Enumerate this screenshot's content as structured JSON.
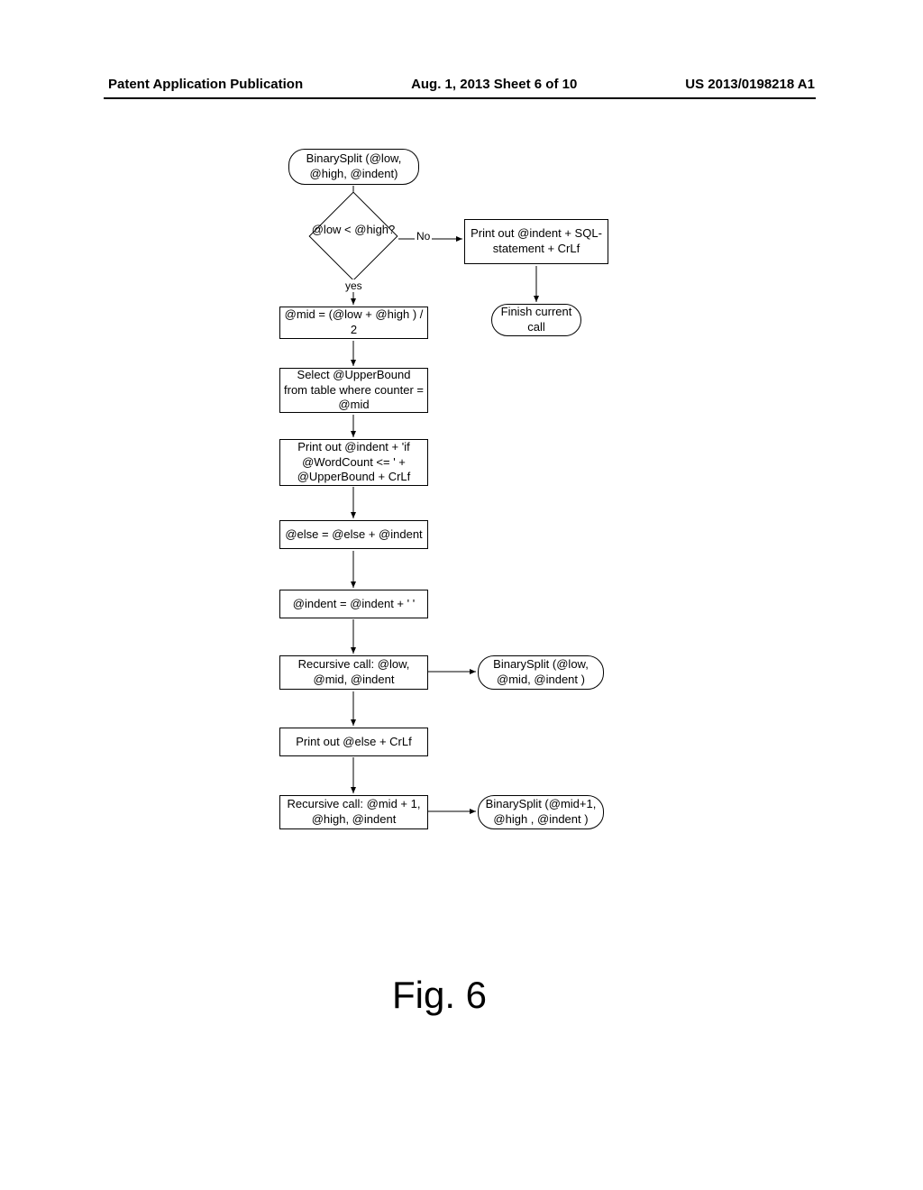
{
  "header": {
    "left": "Patent Application Publication",
    "center": "Aug. 1, 2013   Sheet 6 of 10",
    "right": "US 2013/0198218 A1"
  },
  "diagram": {
    "start": "BinarySplit (@low, @high, @indent)",
    "decision": "@low < @high?",
    "no_label": "No",
    "yes_label": "yes",
    "print_sql": "Print out @indent + SQL-statement + CrLf",
    "finish": "Finish current call",
    "mid_calc": "@mid = (@low + @high ) / 2",
    "select_upper": "Select @UpperBound from table where counter = @mid",
    "print_if": "Print out  @indent  + 'if @WordCount <= ' + @UpperBound + CrLf",
    "else_assign": "@else = @else + @indent",
    "indent_assign": "@indent = @indent + '  '",
    "rec_call1": "Recursive call:  @low, @mid, @indent",
    "bs_call1": "BinarySplit (@low, @mid, @indent )",
    "print_else": "Print out @else + CrLf",
    "rec_call2": "Recursive call: @mid + 1, @high, @indent",
    "bs_call2": "BinarySplit (@mid+1, @high , @indent )"
  },
  "figure_label": "Fig. 6"
}
